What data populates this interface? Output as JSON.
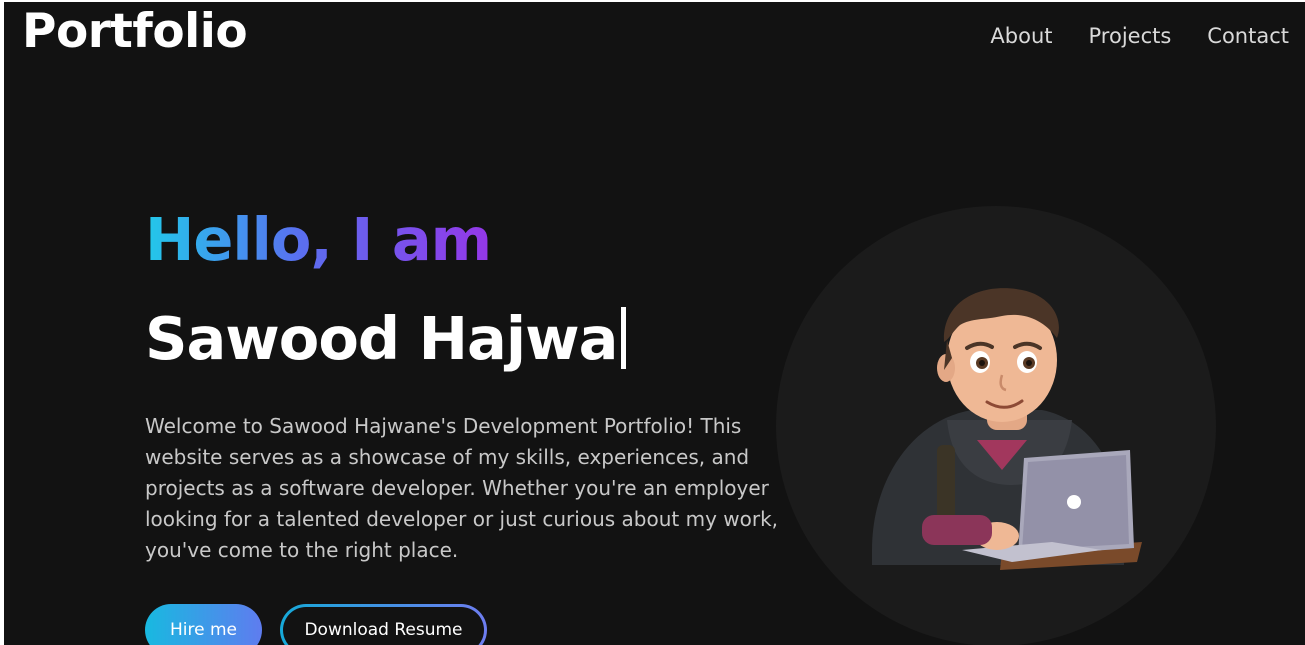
{
  "header": {
    "brand": "Portfolio",
    "nav": [
      {
        "label": "About"
      },
      {
        "label": "Projects"
      },
      {
        "label": "Contact"
      }
    ]
  },
  "hero": {
    "greeting": "Hello, I am",
    "name": "Sawood Hajwa",
    "description": "Welcome to Sawood Hajwane's Development Portfolio! This website serves as a showcase of my skills, experiences, and projects as a software developer. Whether you're an employer looking for a talented developer or just curious about my work, you've come to the right place.",
    "buttons": {
      "hire": "Hire me",
      "resume": "Download Resume"
    },
    "avatar_icon": "developer-avatar-illustration"
  },
  "colors": {
    "background": "#121212",
    "gradient_start": "#22c8ea",
    "gradient_end": "#9537e8",
    "text_muted": "#c8c8c8"
  }
}
